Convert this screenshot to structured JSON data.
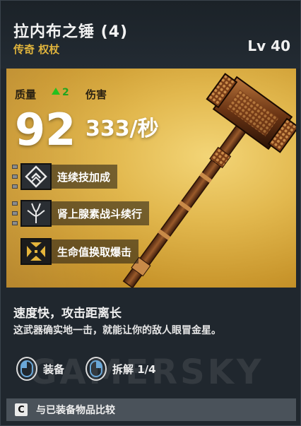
{
  "item": {
    "name": "拉内布之锤 (4)",
    "rarity": "传奇 权杖",
    "level": "Lv 40"
  },
  "stats": {
    "quality_label": "质量",
    "quality_delta": "2",
    "quality_value": "92",
    "damage_label": "伤害",
    "damage_value": "333/秒"
  },
  "perks": [
    {
      "label": "连续技加成",
      "icon": "diamond-chevron-icon"
    },
    {
      "label": "肾上腺素战斗续行",
      "icon": "nerve-icon"
    },
    {
      "label": "生命值换取爆击",
      "icon": "crosshair-arrows-icon"
    }
  ],
  "description": {
    "title": "速度快，攻击距离长",
    "text": "这武器确实地一击，就能让你的敌人眼冒金星。"
  },
  "actions": {
    "equip": "装备",
    "dismantle": "拆解 1/4"
  },
  "footer": {
    "key": "C",
    "compare": "与已装备物品比较"
  },
  "watermark": "GAMERSKY",
  "colors": {
    "panel_gold": "#e2b84e",
    "rarity": "#e0b43c",
    "quality_up": "#25c11e"
  }
}
